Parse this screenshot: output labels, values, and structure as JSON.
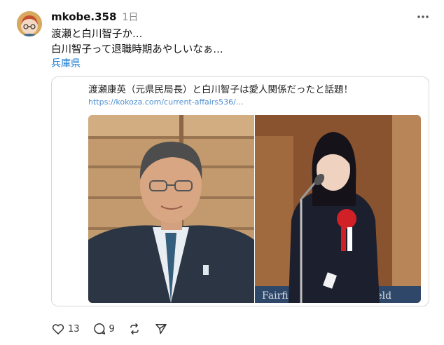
{
  "post": {
    "username": "mkobe.358",
    "timestamp": "1日",
    "lines": [
      "渡瀬と白川智子か…",
      "白川智子って退職時期あやしいなぁ…"
    ],
    "location": "兵庫県"
  },
  "link_card": {
    "title": "渡瀬康英（元県民局長）と白川智子は愛人関係だったと話題！",
    "url": "https://kokoza.com/current-affairs536/…",
    "left_image": "man-in-suit-photo",
    "right_image": "woman-at-podium-photo",
    "right_image_backdrop_text": "Fairfi          field"
  },
  "actions": {
    "like_count": "13",
    "reply_count": "9"
  },
  "icons": {
    "more": "more-horizontal-icon",
    "like": "heart-icon",
    "reply": "comment-icon",
    "repost": "repost-icon",
    "share": "send-icon"
  },
  "colors": {
    "link": "#1a7bd1",
    "url": "#4f8fcf",
    "muted": "#8a8a8a"
  }
}
